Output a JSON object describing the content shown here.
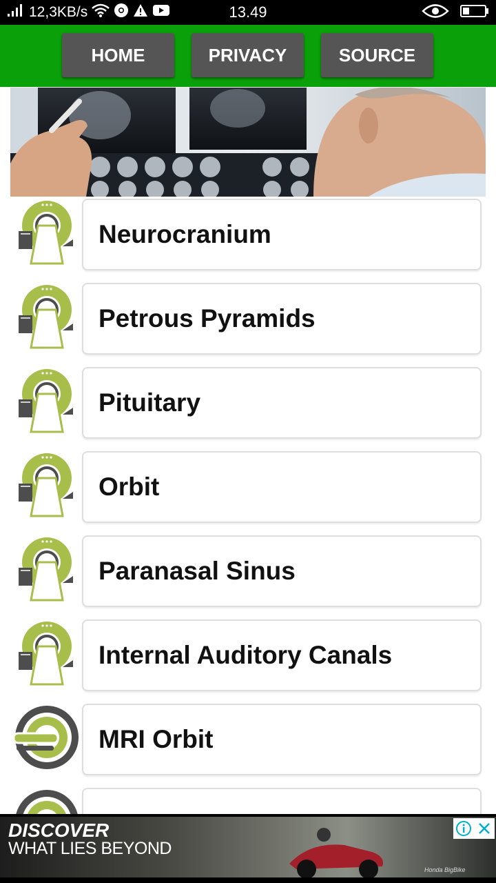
{
  "status_bar": {
    "network_speed": "12,3KB/s",
    "time": "13.49"
  },
  "nav": {
    "home_label": "HOME",
    "privacy_label": "PRIVACY",
    "source_label": "SOURCE"
  },
  "hero": {
    "image": "doctor-viewing-xray-image"
  },
  "items": [
    {
      "label": "Neurocranium",
      "icon": "ct-scanner-icon"
    },
    {
      "label": "Petrous Pyramids",
      "icon": "ct-scanner-icon"
    },
    {
      "label": "Pituitary",
      "icon": "ct-scanner-icon"
    },
    {
      "label": "Orbit",
      "icon": "ct-scanner-icon"
    },
    {
      "label": "Paranasal Sinus",
      "icon": "ct-scanner-icon"
    },
    {
      "label": "Internal Auditory Canals",
      "icon": "ct-scanner-icon"
    },
    {
      "label": "MRI Orbit",
      "icon": "mri-scanner-icon"
    },
    {
      "label": "",
      "icon": "mri-scanner-icon"
    }
  ],
  "ad": {
    "headline": "DISCOVER",
    "subline": "WHAT LIES BEYOND",
    "brand": "Honda BigBike"
  },
  "colors": {
    "nav_green": "#0aa00a",
    "button_gray": "#555555",
    "icon_green": "#a7bf4a",
    "icon_gray": "#4d4d4d"
  }
}
